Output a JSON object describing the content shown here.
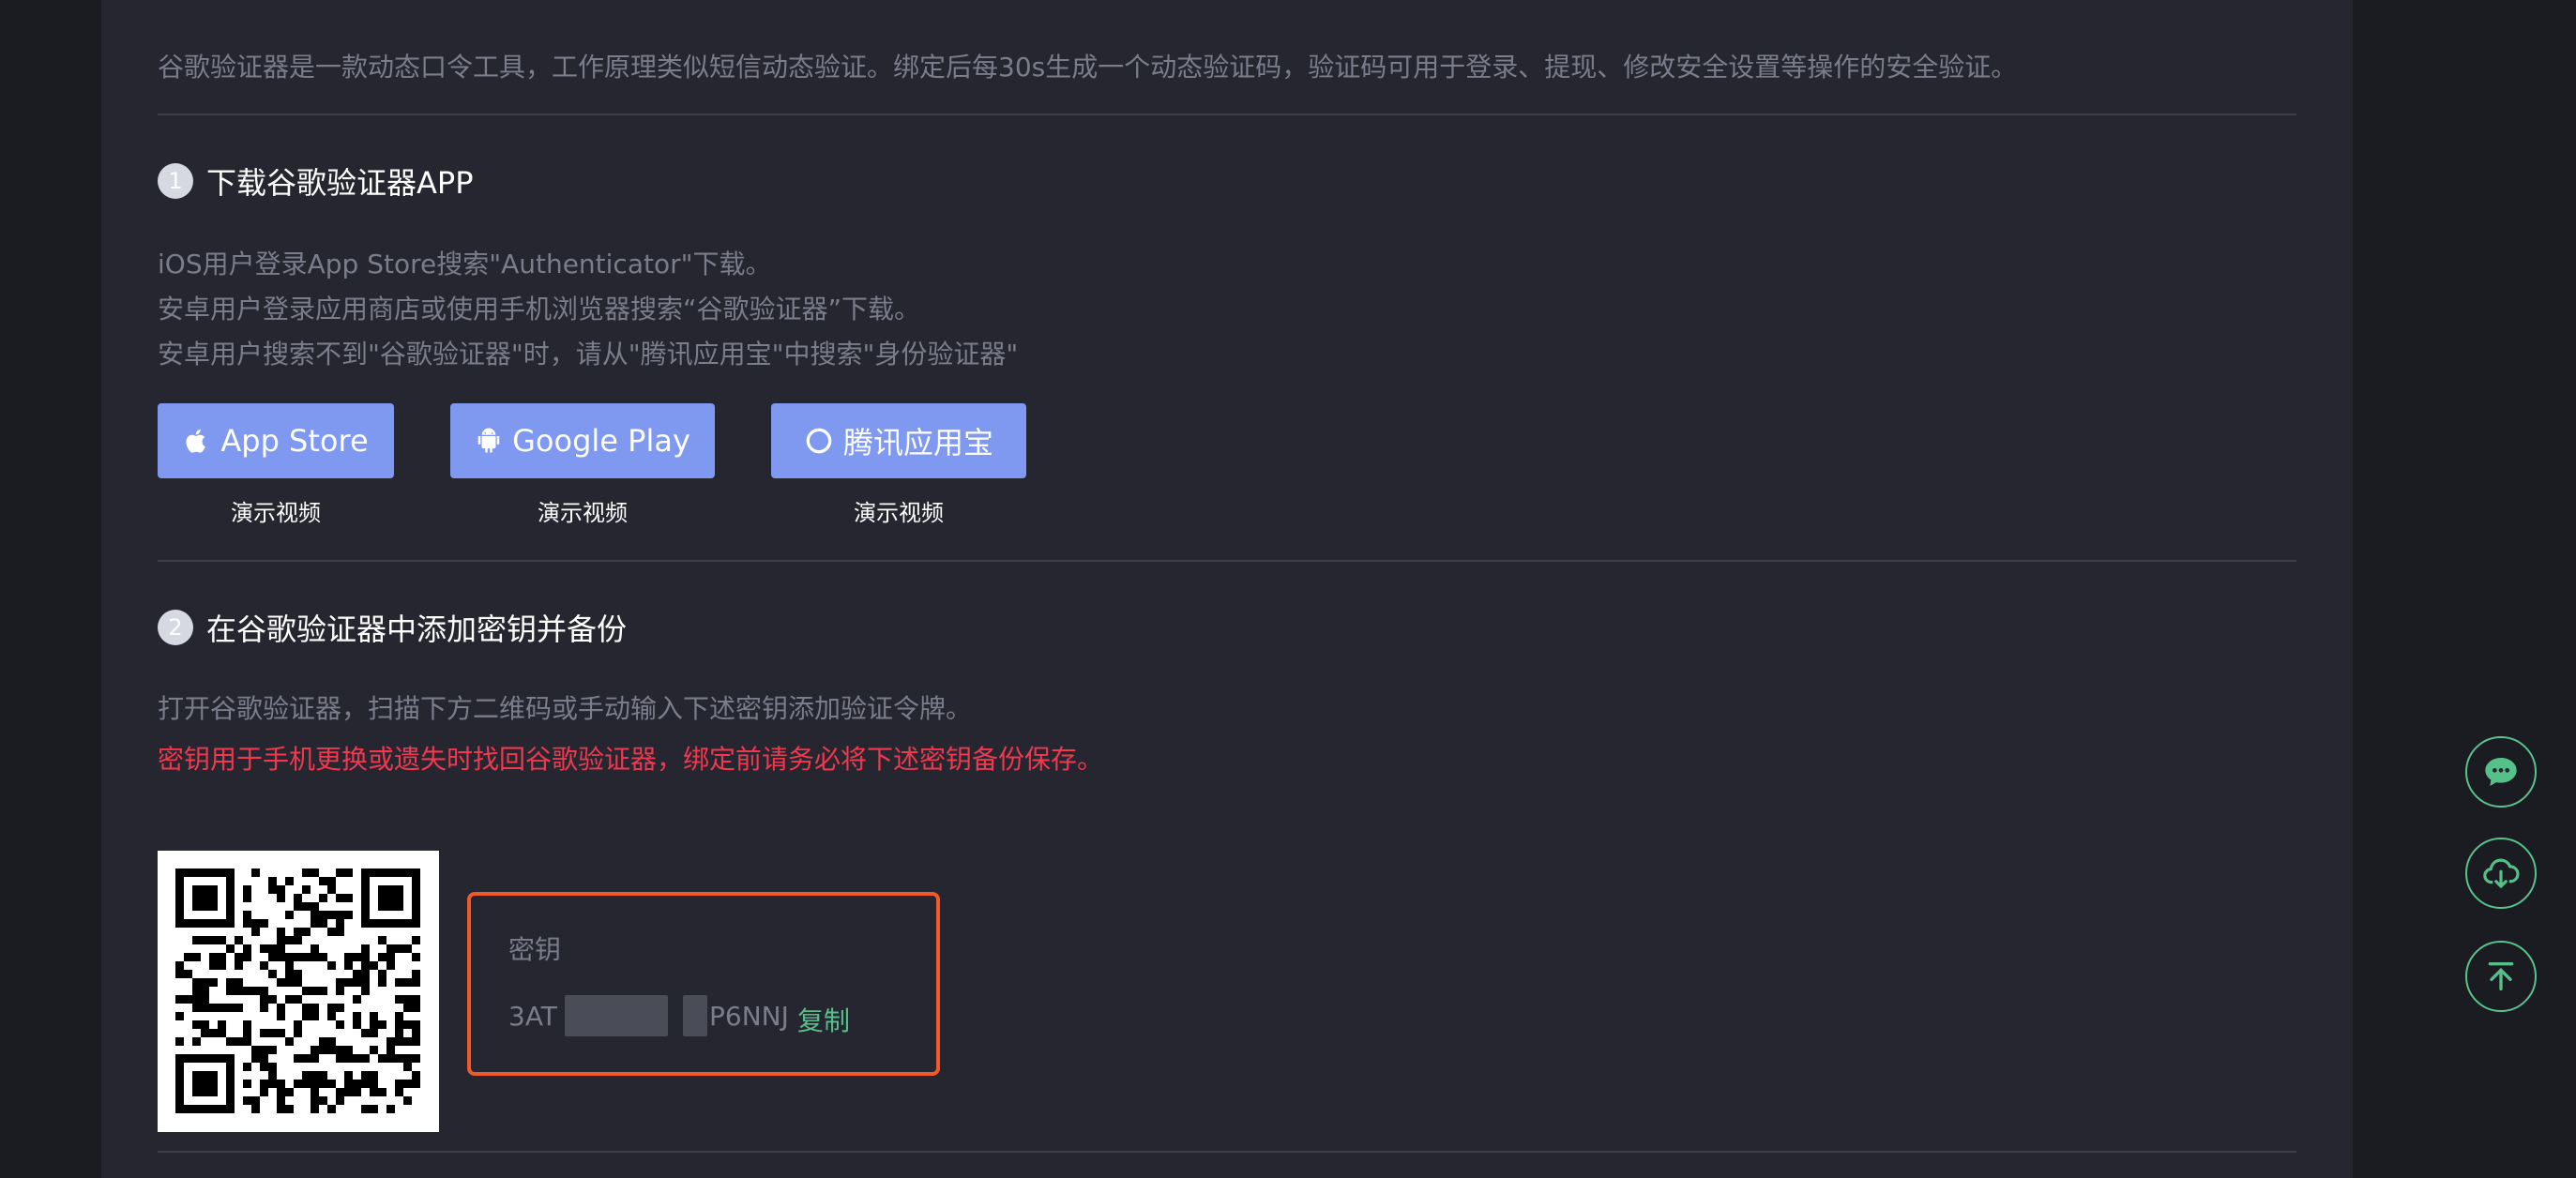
{
  "intro": "谷歌验证器是一款动态口令工具，工作原理类似短信动态验证。绑定后每30s生成一个动态验证码，验证码可用于登录、提现、修改安全设置等操作的安全验证。",
  "step1": {
    "number": "1",
    "title": "下载谷歌验证器APP",
    "lines": [
      "iOS用户登录App Store搜索\"Authenticator\"下载。",
      "安卓用户登录应用商店或使用手机浏览器搜索“谷歌验证器”下载。",
      "安卓用户搜索不到\"谷歌验证器\"时，请从\"腾讯应用宝\"中搜索\"身份验证器\""
    ],
    "buttons": [
      {
        "label": "App Store",
        "icon": "apple-icon",
        "video": "演示视频"
      },
      {
        "label": "Google Play",
        "icon": "android-icon",
        "video": "演示视频"
      },
      {
        "label": "腾讯应用宝",
        "icon": "tencent-icon",
        "video": "演示视频"
      }
    ]
  },
  "step2": {
    "number": "2",
    "title": "在谷歌验证器中添加密钥并备份",
    "line": "打开谷歌验证器，扫描下方二维码或手动输入下述密钥添加验证令牌。",
    "warning": "密钥用于手机更换或遗失时找回谷歌验证器，绑定前请务必将下述密钥备份保存。",
    "key_label": "密钥",
    "key_prefix": "3AT",
    "key_suffix": "P6NNJ",
    "copy_label": "复制"
  },
  "floating": {
    "icons": [
      "chat-icon",
      "cloud-download-icon",
      "back-to-top-icon"
    ]
  },
  "colors": {
    "accent_button": "#7f98f0",
    "warning": "#f0394f",
    "highlight_border": "#f05a28",
    "green": "#55c08a"
  }
}
